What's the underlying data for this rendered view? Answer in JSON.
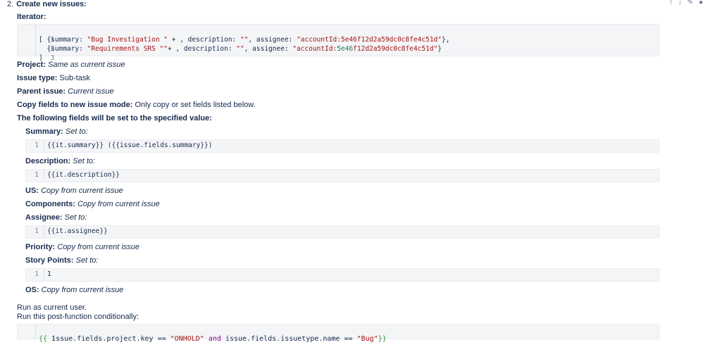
{
  "header": {
    "step_number": "2.",
    "title": "Create new issues:",
    "icons": [
      "arrow-up-icon",
      "arrow-down-icon",
      "edit-icon",
      "delete-icon"
    ]
  },
  "iterator": {
    "label": "Iterator:",
    "lines": [
      {
        "n": "1",
        "p1": "[ {summary: ",
        "s1": "\"Bug Investigation \"",
        "p2": " + , description: ",
        "s2": "\"\"",
        "p3": ", assignee: ",
        "s3": "\"accountId:5e46f12d2a59dc0c8fe4c51d\"",
        "p4": "},"
      },
      {
        "n": "2",
        "p1": "  {summary: ",
        "s1": "\"Requirements SRS \"\"",
        "p2": "+ , description: ",
        "s2": "\"\"",
        "p3": ", assignee: ",
        "s3a": "\"accountId:",
        "g": "5e46",
        "s3b": "f12d2a59dc0c8fe4c51d\"",
        "p4": "}"
      },
      {
        "n": "3",
        "p1": "]"
      }
    ]
  },
  "project": {
    "label": "Project:",
    "value": "Same as current issue"
  },
  "issue_type": {
    "label": "Issue type:",
    "value": "Sub-task"
  },
  "parent_issue": {
    "label": "Parent issue:",
    "value": "Current issue"
  },
  "copy_mode": {
    "label": "Copy fields to new issue mode:",
    "value": "Only copy or set fields listed below."
  },
  "fields_heading": "The following fields will be set to the specified value:",
  "summary": {
    "label": "Summary:",
    "value": "Set to:",
    "ln": "1",
    "code": "{{it.summary}} ({{issue.fields.summary}})"
  },
  "description": {
    "label": "Description:",
    "value": "Set to:",
    "ln": "1",
    "code": "{{it.description}}"
  },
  "us": {
    "label": "US:",
    "value": "Copy from current issue"
  },
  "components": {
    "label": "Components:",
    "value": "Copy from current issue"
  },
  "assignee": {
    "label": "Assignee:",
    "value": "Set to:",
    "ln": "1",
    "code": "{{it.assignee}}"
  },
  "priority": {
    "label": "Priority:",
    "value": "Copy from current issue"
  },
  "story_points": {
    "label": "Story Points:",
    "value": "Set to:",
    "ln": "1",
    "code": "1"
  },
  "os": {
    "label": "OS:",
    "value": "Copy from current issue"
  },
  "run_as": "Run as current user.",
  "run_conditionally": "Run this post-function conditionally:",
  "condition": {
    "ln": "1",
    "open": "{{",
    "t1": " issue.fields.project.key == ",
    "s1": "\"ONHOLD\"",
    "k": " and",
    "t2": " issue.fields.issuetype.name == ",
    "s2": "\"Bug\"",
    "close": "}}"
  }
}
